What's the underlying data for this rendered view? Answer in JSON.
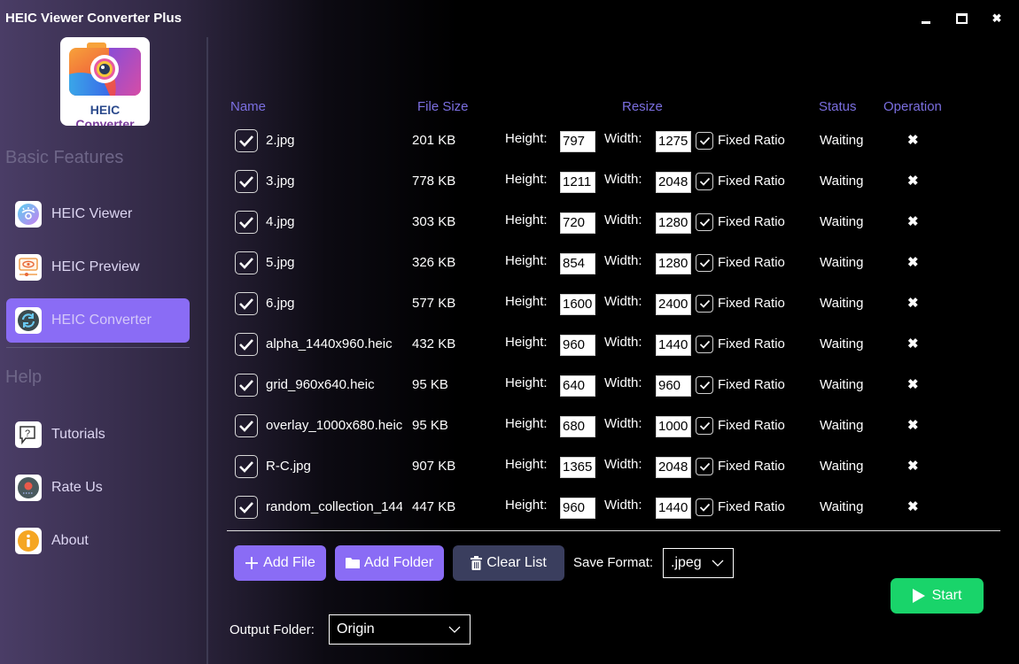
{
  "window": {
    "title": "HEIC Viewer Converter Plus",
    "controls": {
      "minimize": "minimize",
      "maximize": "maximize",
      "close": "✖"
    }
  },
  "logo": {
    "text_a": "HEIC",
    "text_b": "Converter"
  },
  "sidebar": {
    "sections": [
      {
        "title": "Basic Features"
      },
      {
        "title": "Help"
      }
    ],
    "items": [
      {
        "label": "HEIC Viewer",
        "icon": "eye-lashes-icon",
        "active": false
      },
      {
        "label": "HEIC Preview",
        "icon": "monitor-eye-icon",
        "active": false
      },
      {
        "label": "HEIC Converter",
        "icon": "refresh-cycle-icon",
        "active": true
      },
      {
        "label": "Tutorials",
        "icon": "help-chat-icon",
        "active": false
      },
      {
        "label": "Rate Us",
        "icon": "rate-icon",
        "active": false
      },
      {
        "label": "About",
        "icon": "info-icon",
        "active": false
      }
    ]
  },
  "table": {
    "headers": {
      "name": "Name",
      "size": "File Size",
      "resize": "Resize",
      "status": "Status",
      "operation": "Operation"
    },
    "labels": {
      "height": "Height:",
      "width": "Width:",
      "fixed_ratio": "Fixed Ratio",
      "remove": "✖"
    },
    "rows": [
      {
        "name": "2.jpg",
        "size": "201 KB",
        "height": "797",
        "width": "1275",
        "fixed_ratio": true,
        "checked": true,
        "status": "Waiting"
      },
      {
        "name": "3.jpg",
        "size": "778 KB",
        "height": "1211",
        "width": "2048",
        "fixed_ratio": true,
        "checked": true,
        "status": "Waiting"
      },
      {
        "name": "4.jpg",
        "size": "303 KB",
        "height": "720",
        "width": "1280",
        "fixed_ratio": true,
        "checked": true,
        "status": "Waiting"
      },
      {
        "name": "5.jpg",
        "size": "326 KB",
        "height": "854",
        "width": "1280",
        "fixed_ratio": true,
        "checked": true,
        "status": "Waiting"
      },
      {
        "name": "6.jpg",
        "size": "577 KB",
        "height": "1600",
        "width": "2400",
        "fixed_ratio": true,
        "checked": true,
        "status": "Waiting"
      },
      {
        "name": "alpha_1440x960.heic",
        "size": "432 KB",
        "height": "960",
        "width": "1440",
        "fixed_ratio": true,
        "checked": true,
        "status": "Waiting"
      },
      {
        "name": "grid_960x640.heic",
        "size": "95 KB",
        "height": "640",
        "width": "960",
        "fixed_ratio": true,
        "checked": true,
        "status": "Waiting"
      },
      {
        "name": "overlay_1000x680.heic",
        "size": "95 KB",
        "height": "680",
        "width": "1000",
        "fixed_ratio": true,
        "checked": true,
        "status": "Waiting"
      },
      {
        "name": "R-C.jpg",
        "size": "907 KB",
        "height": "1365",
        "width": "2048",
        "fixed_ratio": true,
        "checked": true,
        "status": "Waiting"
      },
      {
        "name": "random_collection_144",
        "size": "447 KB",
        "height": "960",
        "width": "1440",
        "fixed_ratio": true,
        "checked": true,
        "status": "Waiting"
      }
    ]
  },
  "toolbar": {
    "add_file": "Add File",
    "add_folder": "Add Folder",
    "clear_list": "Clear List",
    "save_format_label": "Save Format:",
    "save_format_value": ".jpeg",
    "output_folder_label": "Output Folder:",
    "output_folder_value": "Origin",
    "start": "Start"
  },
  "colors": {
    "accent": "#8a6cf5",
    "header_text": "#7b6fe0",
    "start_green": "#19d46a",
    "clear_button": "#3a3e5e"
  }
}
